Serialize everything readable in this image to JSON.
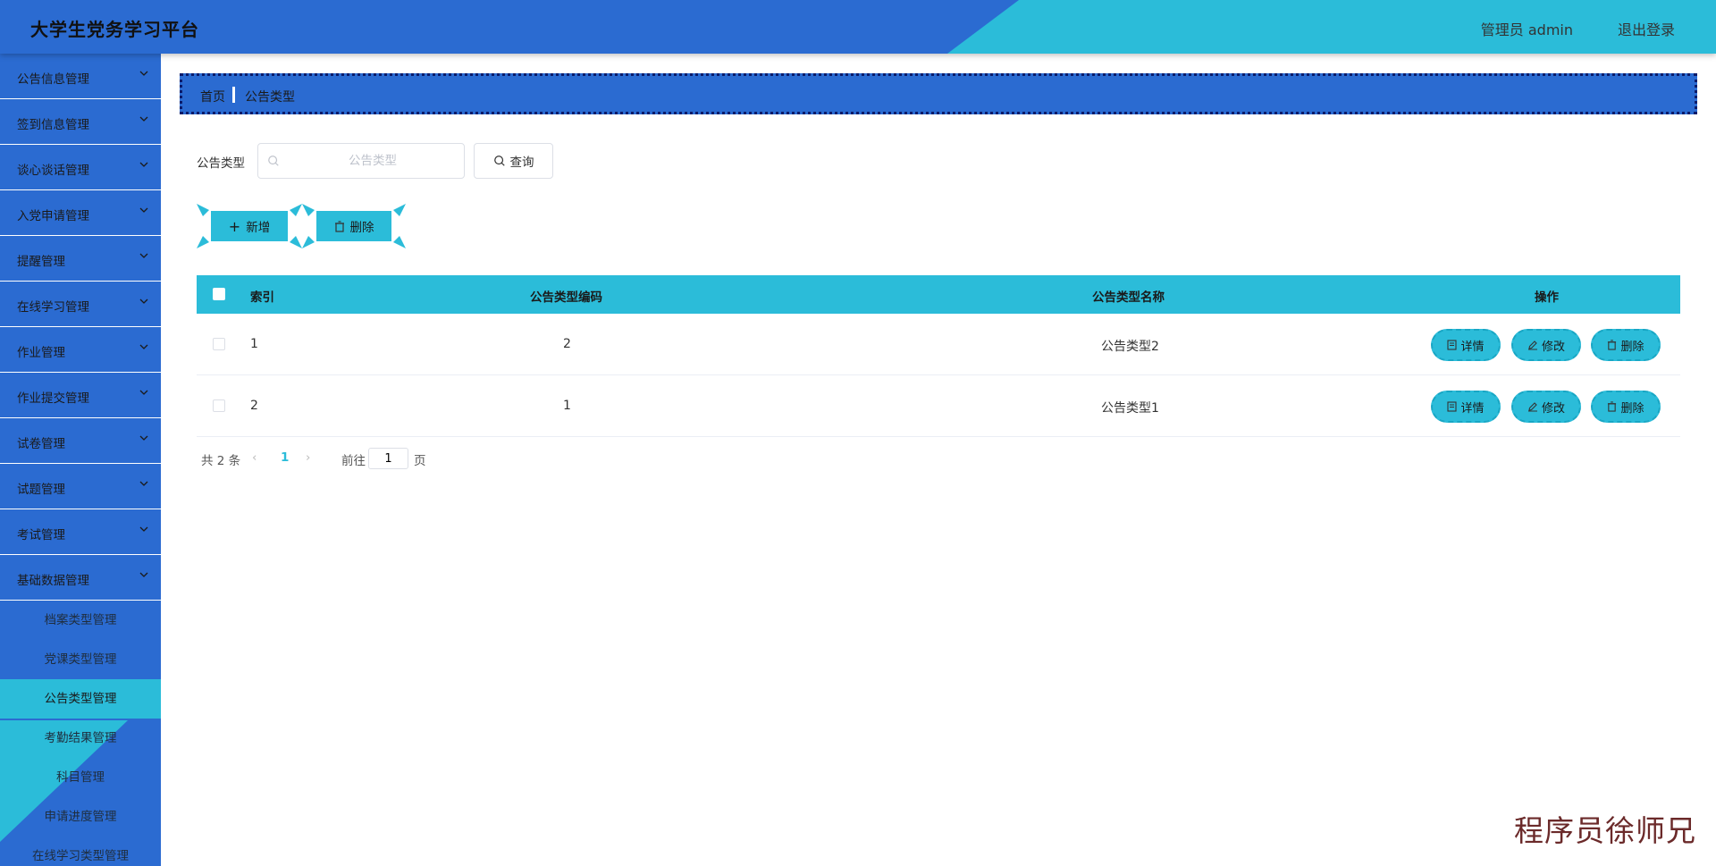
{
  "app": {
    "title": "大学生党务学习平台"
  },
  "header": {
    "user": "管理员 admin",
    "logout": "退出登录"
  },
  "sidebar": {
    "menus": [
      {
        "label": "公告信息管理"
      },
      {
        "label": "签到信息管理"
      },
      {
        "label": "谈心谈话管理"
      },
      {
        "label": "入党申请管理"
      },
      {
        "label": "提醒管理"
      },
      {
        "label": "在线学习管理"
      },
      {
        "label": "作业管理"
      },
      {
        "label": "作业提交管理"
      },
      {
        "label": "试卷管理"
      },
      {
        "label": "试题管理"
      },
      {
        "label": "考试管理"
      },
      {
        "label": "基础数据管理"
      }
    ],
    "submenu": [
      {
        "label": "档案类型管理"
      },
      {
        "label": "党课类型管理"
      },
      {
        "label": "公告类型管理",
        "active": true
      },
      {
        "label": "考勤结果管理"
      },
      {
        "label": "科目管理"
      },
      {
        "label": "申请进度管理"
      },
      {
        "label": "在线学习类型管理"
      }
    ]
  },
  "breadcrumb": {
    "home": "首页",
    "current": "公告类型"
  },
  "search": {
    "label": "公告类型",
    "placeholder": "公告类型",
    "value": "",
    "button": "查询"
  },
  "actions": {
    "add": "新增",
    "delete": "删除"
  },
  "table": {
    "headers": {
      "index": "索引",
      "code": "公告类型编码",
      "name": "公告类型名称",
      "ops": "操作"
    },
    "rows": [
      {
        "index": "1",
        "code": "2",
        "name": "公告类型2"
      },
      {
        "index": "2",
        "code": "1",
        "name": "公告类型1"
      }
    ],
    "row_buttons": {
      "detail": "详情",
      "edit": "修改",
      "delete": "删除"
    }
  },
  "pagination": {
    "total": "共 2 条",
    "page": "1",
    "goto": "前往",
    "goto_value": "1",
    "unit": "页"
  },
  "watermark": "程序员徐师兄",
  "colors": {
    "primary_blue": "#2b6bd1",
    "accent_cyan": "#2bbcd9"
  }
}
